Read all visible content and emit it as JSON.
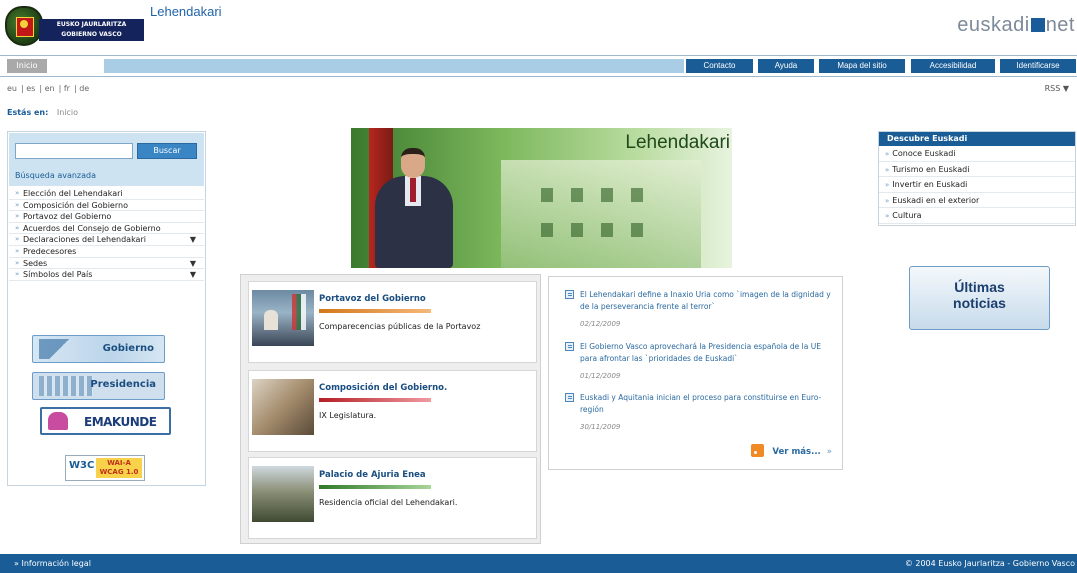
{
  "header": {
    "logo_text_line1": "EUSKO JAURLARITZA",
    "logo_text_line2": "GOBIERNO VASCO",
    "site_title": "Lehendakari",
    "portal_brand_part1": "euskadi",
    "portal_brand_part2": "net"
  },
  "topnav": {
    "home_label": "Inicio",
    "items": [
      "Contacto",
      "Ayuda",
      "Mapa del sitio",
      "Accesibilidad",
      "Identificarse"
    ]
  },
  "languages": [
    "eu",
    "es",
    "en",
    "fr",
    "de"
  ],
  "rss_top": "RSS",
  "breadcrumb": {
    "label": "Estás en:",
    "current": "Inicio"
  },
  "search": {
    "input_value": "",
    "button_label": "Buscar",
    "advanced_label": "Búsqueda avanzada"
  },
  "leftmenu": [
    {
      "label": "Elección del Lehendakari",
      "expandable": false
    },
    {
      "label": "Composición del Gobierno",
      "expandable": false
    },
    {
      "label": "Portavoz del Gobierno",
      "expandable": false
    },
    {
      "label": "Acuerdos del Consejo de Gobierno",
      "expandable": false
    },
    {
      "label": "Declaraciones del Lehendakari",
      "expandable": true
    },
    {
      "label": "Predecesores",
      "expandable": false
    },
    {
      "label": "Sedes",
      "expandable": true
    },
    {
      "label": "Símbolos del País",
      "expandable": true
    }
  ],
  "links": {
    "gobierno": "Gobierno",
    "presidencia": "Presidencia",
    "emakunde": "EMAKUNDE",
    "wai_w3c": "W3C",
    "wai_line1": "WAI-A",
    "wai_line2": "WCAG 1.0"
  },
  "hero": {
    "title": "Lehendakari"
  },
  "descubre": {
    "title": "Descubre Euskadi",
    "items": [
      "Conoce Euskadi",
      "Turismo en Euskadi",
      "Invertir en Euskadi",
      "Euskadi en el exterior",
      "Cultura"
    ]
  },
  "ultimas": {
    "line1": "Últimas",
    "line2": "noticias"
  },
  "features": [
    {
      "title": "Portavoz del Gobierno",
      "desc": "Comparecencias públicas de la Portavoz",
      "color": "#d4761a"
    },
    {
      "title": "Composición del Gobierno.",
      "desc": "IX Legislatura.",
      "color": "#b51e26"
    },
    {
      "title": "Palacio de Ajuria Enea",
      "desc": "Residencia oficial del Lehendakari.",
      "color": "#2f7a2a"
    }
  ],
  "news": {
    "items": [
      {
        "text": "El Lehendakari define a Inaxio Uria como `imagen de la dignidad y de la perseverancia frente al terror`",
        "date": "02/12/2009"
      },
      {
        "text": "El Gobierno Vasco aprovechará la Presidencia española de la UE para afrontar las `prioridades de Euskadi`",
        "date": "01/12/2009"
      },
      {
        "text": "Euskadi y Aquitania inician el proceso para constituirse en Euro-región",
        "date": "30/11/2009"
      }
    ],
    "more_label": "Ver más...",
    "more_sep": "»"
  },
  "footer": {
    "legal": "Información legal",
    "copyright": "© 2004 Eusko Jaurlaritza - Gobierno Vasco"
  },
  "colors": {
    "primary_blue": "#1a5c96",
    "light_blue": "#a8cde4",
    "rss_orange": "#f08a24"
  }
}
